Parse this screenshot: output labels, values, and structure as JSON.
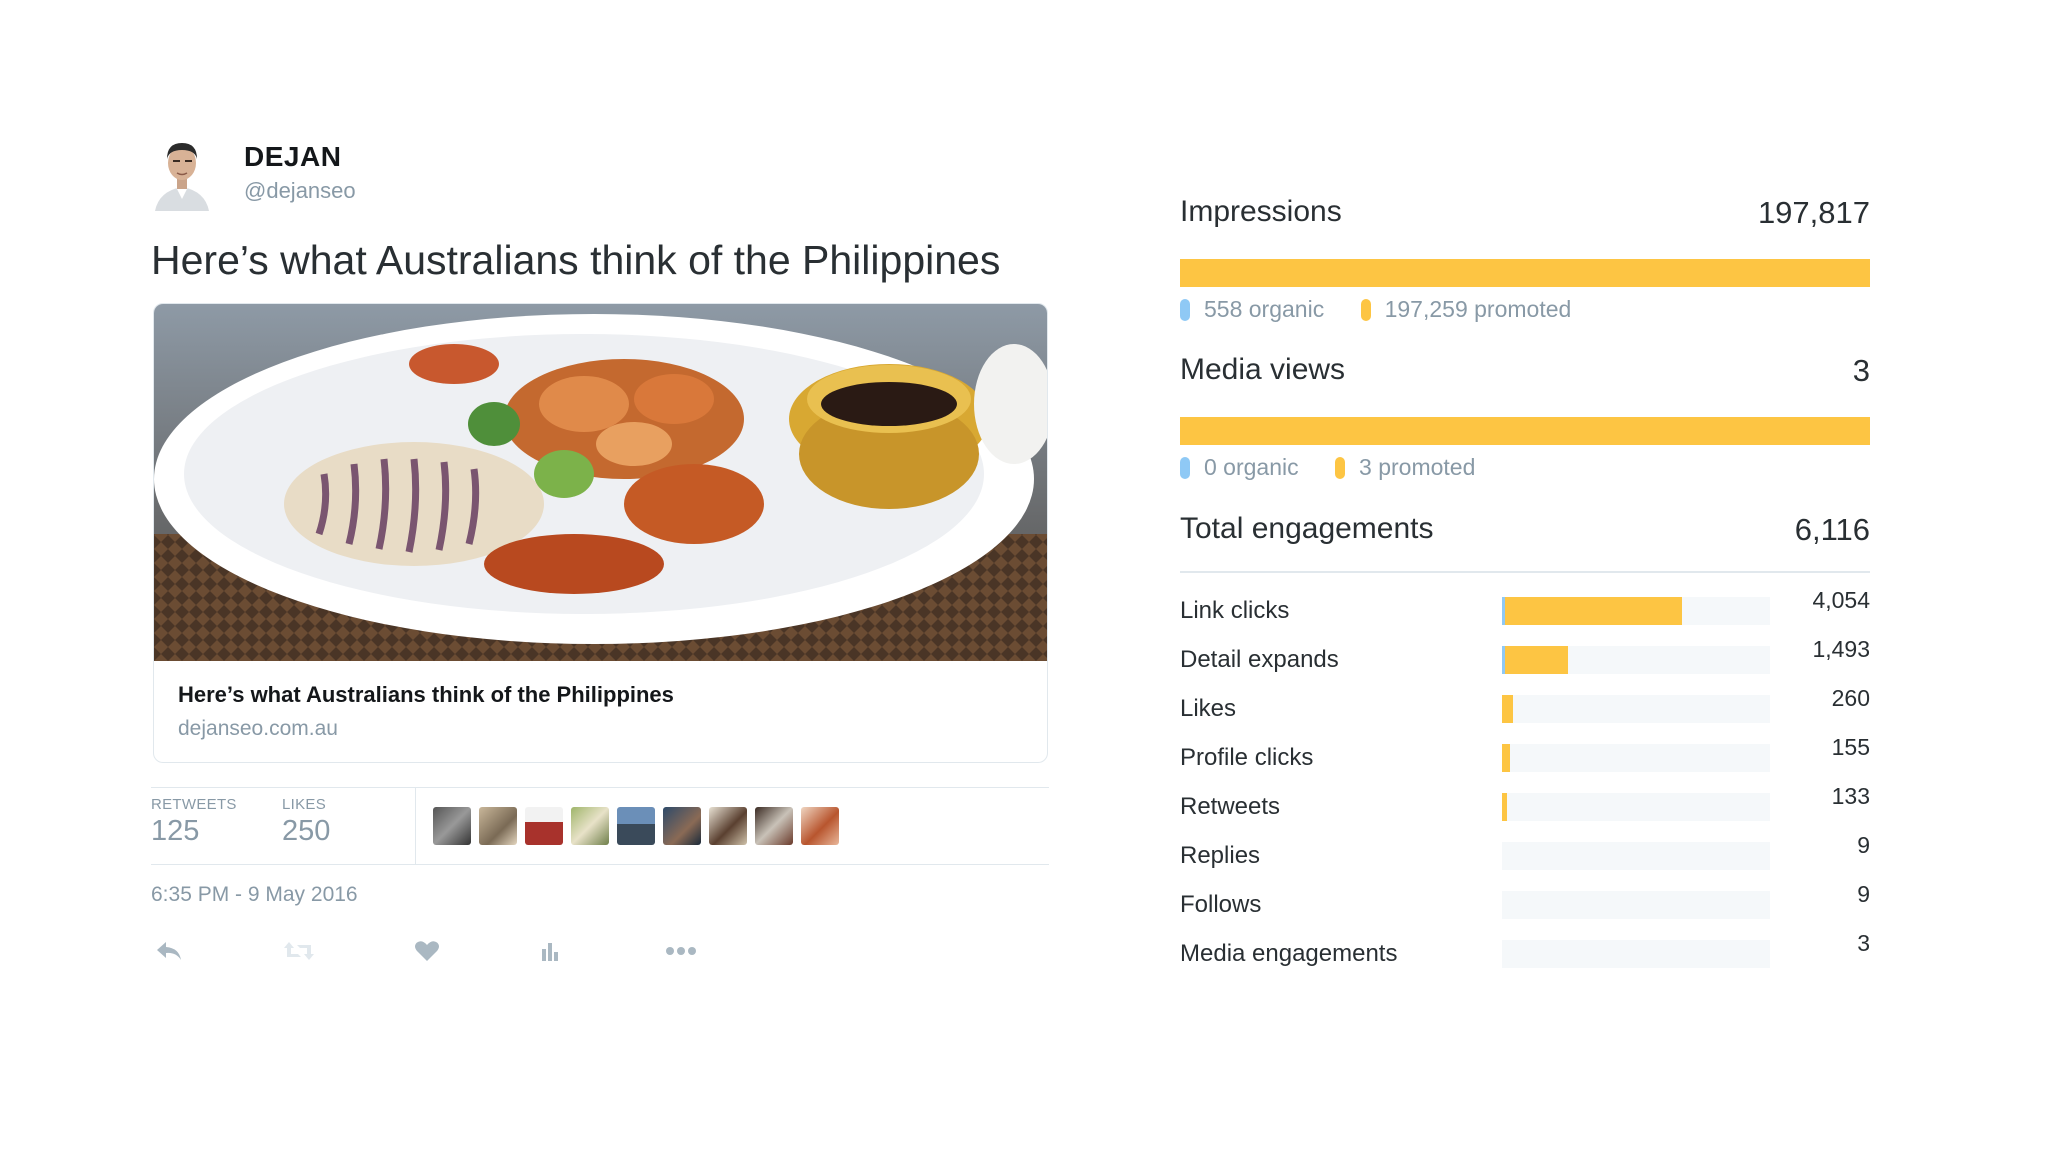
{
  "tweet": {
    "author_name": "DEJAN",
    "author_handle": "@dejanseo",
    "text": "Here’s what Australians think of the Philippines",
    "card": {
      "title": "Here’s what Australians think of the Philippines",
      "domain": "dejanseo.com.au"
    },
    "stats": {
      "retweets_label": "RETWEETS",
      "retweets_value": "125",
      "likes_label": "LIKES",
      "likes_value": "250"
    },
    "timestamp": "6:35 PM - 9 May 2016",
    "actions": [
      "reply-icon",
      "retweet-icon",
      "heart-icon",
      "analytics-icon",
      "more-icon"
    ]
  },
  "analytics": {
    "colors": {
      "promoted": "#fdc543",
      "organic": "#8fc9f5"
    },
    "impressions": {
      "label": "Impressions",
      "value": "197,817",
      "organic": "558 organic",
      "promoted": "197,259 promoted"
    },
    "media_views": {
      "label": "Media views",
      "value": "3",
      "organic": "0 organic",
      "promoted": "3 promoted"
    },
    "engagements": {
      "label": "Total engagements",
      "value": "6,116",
      "rows": [
        {
          "label": "Link clicks",
          "value": "4,054",
          "fraction": 0.67,
          "organic": true
        },
        {
          "label": "Detail expands",
          "value": "1,493",
          "fraction": 0.245,
          "organic": true
        },
        {
          "label": "Likes",
          "value": "260",
          "fraction": 0.042,
          "organic": false
        },
        {
          "label": "Profile clicks",
          "value": "155",
          "fraction": 0.03,
          "organic": false
        },
        {
          "label": "Retweets",
          "value": "133",
          "fraction": 0.02,
          "organic": false
        },
        {
          "label": "Replies",
          "value": "9",
          "fraction": 0,
          "organic": false
        },
        {
          "label": "Follows",
          "value": "9",
          "fraction": 0,
          "organic": false
        },
        {
          "label": "Media engagements",
          "value": "3",
          "fraction": 0,
          "organic": false
        }
      ]
    }
  }
}
